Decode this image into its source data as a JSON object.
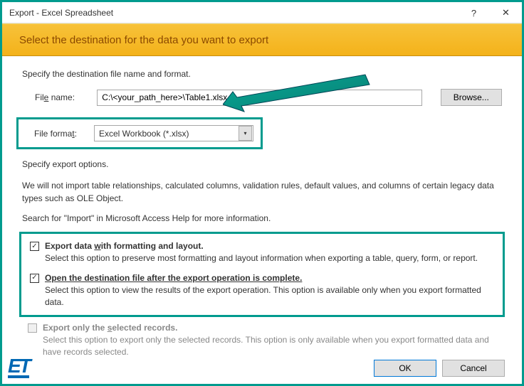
{
  "title": "Export - Excel Spreadsheet",
  "banner": "Select the destination for the data you want to export",
  "section1": "Specify the destination file name and format.",
  "filename_label_pre": "Fil",
  "filename_label_u": "e",
  "filename_label_post": " name:",
  "filename_value": "C:\\<your_path_here>\\Table1.xlsx",
  "browse_label": "Browse...",
  "format_label_pre": "File forma",
  "format_label_u": "t",
  "format_label_post": ":",
  "format_value": "Excel Workbook (*.xlsx)",
  "section2": "Specify export options.",
  "info1": "We will not import table relationships, calculated columns, validation rules, default values, and columns of certain legacy data types such as OLE Object.",
  "info2": "Search for \"Import\" in Microsoft Access Help for more information.",
  "opt1_pre": "Export data ",
  "opt1_u": "w",
  "opt1_post": "ith formatting and layout.",
  "opt1_desc": "Select this option to preserve most formatting and layout information when exporting a table, query, form, or report.",
  "opt2_pre": "Open the destination file after the export operation is c",
  "opt2_u": "o",
  "opt2_post": "mplete.",
  "opt2_desc": "Select this option to view the results of the export operation. This option is available only when you export formatted data.",
  "opt3_pre": "Export only the ",
  "opt3_u": "s",
  "opt3_post": "elected records.",
  "opt3_desc": "Select this option to export only the selected records. This option is only available when you export formatted data and have records selected.",
  "ok_label": "OK",
  "cancel_label": "Cancel",
  "logo": "ET"
}
